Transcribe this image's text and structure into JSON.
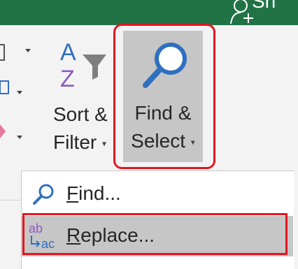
{
  "titlebar": {
    "share_label": "Sh",
    "color": "#217346"
  },
  "ribbon": {
    "sort_filter": {
      "label_line1": "Sort &",
      "label_line2": "Filter",
      "letter_top": "A",
      "letter_bottom": "Z"
    },
    "find_select": {
      "label_line1": "Find &",
      "label_line2": "Select"
    }
  },
  "menu": {
    "items": [
      {
        "label_underlined": "F",
        "label_rest": "ind...",
        "icon": "magnifier-icon"
      },
      {
        "label_underlined": "R",
        "label_rest": "eplace...",
        "icon": "replace-icon",
        "icon_text_top": "ab",
        "icon_text_bottom": "ac"
      }
    ]
  },
  "colors": {
    "highlight": "#e4161f",
    "accent_blue": "#2f6fbf",
    "purple": "#8e5cc0",
    "hover_gray": "#c6c6c6"
  }
}
